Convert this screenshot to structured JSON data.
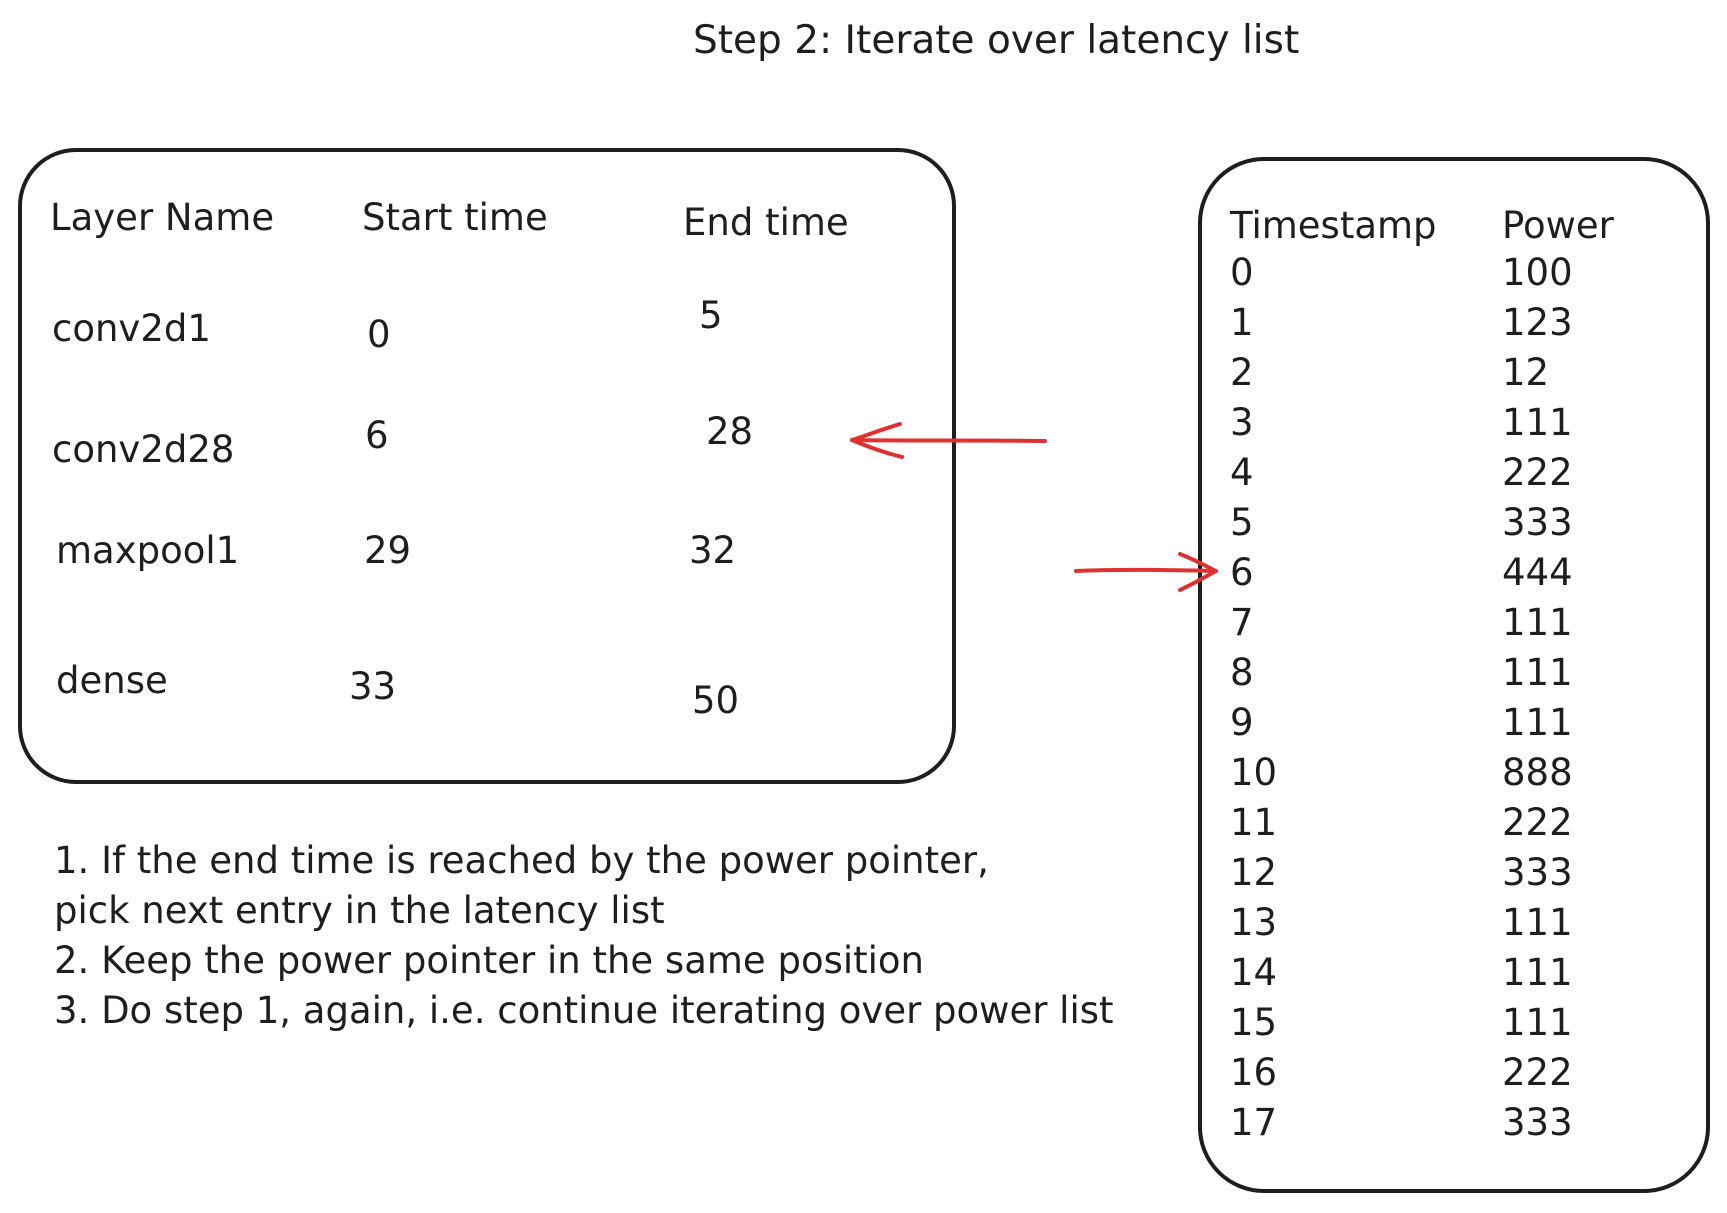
{
  "title": "Step 2: Iterate over latency list",
  "latency_list": {
    "headers": [
      "Layer Name",
      "Start time",
      "End time"
    ],
    "rows": [
      [
        "conv2d1",
        "0",
        "5"
      ],
      [
        "conv2d28",
        "6",
        "28"
      ],
      [
        "maxpool1",
        "29",
        "32"
      ],
      [
        "dense",
        "33",
        "50"
      ]
    ]
  },
  "power_list": {
    "headers": [
      "Timestamp",
      "Power"
    ],
    "rows": [
      [
        "0",
        "100"
      ],
      [
        "1",
        "123"
      ],
      [
        "2",
        "12"
      ],
      [
        "3",
        "111"
      ],
      [
        "4",
        "222"
      ],
      [
        "5",
        "333"
      ],
      [
        "6",
        "444"
      ],
      [
        "7",
        "111"
      ],
      [
        "8",
        "111"
      ],
      [
        "9",
        "111"
      ],
      [
        "10",
        "888"
      ],
      [
        "11",
        "222"
      ],
      [
        "12",
        "333"
      ],
      [
        "13",
        "111"
      ],
      [
        "14",
        "111"
      ],
      [
        "15",
        "111"
      ],
      [
        "16",
        "222"
      ],
      [
        "17",
        "333"
      ]
    ]
  },
  "notes": [
    "1. If the end time is reached by the power pointer,",
    "pick next entry in the latency list",
    "2. Keep the power pointer in the same position",
    "3. Do step 1, again, i.e. continue iterating over power list"
  ],
  "colors": {
    "stroke": "#1e1e1e",
    "pointer": "#e03131"
  }
}
